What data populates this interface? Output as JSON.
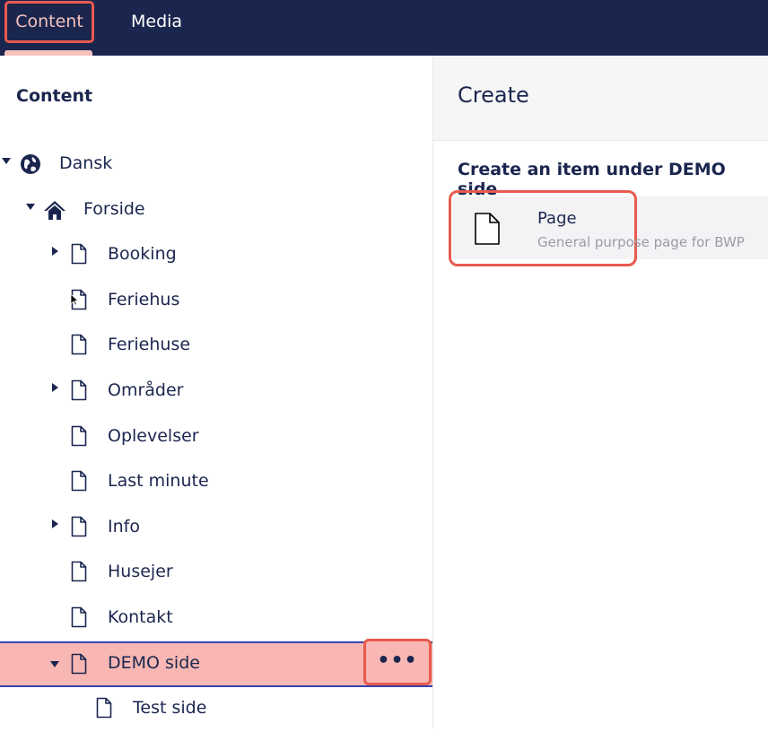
{
  "topnav": {
    "content_label": "Content",
    "media_label": "Media"
  },
  "tree": {
    "title": "Content",
    "rows": [
      {
        "label": "Dansk",
        "icon": "globe-icon",
        "expander": "down"
      },
      {
        "label": "Forside",
        "icon": "home-icon",
        "expander": "down"
      },
      {
        "label": "Booking",
        "icon": "document-icon",
        "expander": "right"
      },
      {
        "label": "Feriehus",
        "icon": "document-icon",
        "expander": "none"
      },
      {
        "label": "Feriehuse",
        "icon": "document-icon",
        "expander": "none"
      },
      {
        "label": "Områder",
        "icon": "document-icon",
        "expander": "right"
      },
      {
        "label": "Oplevelser",
        "icon": "document-icon",
        "expander": "none"
      },
      {
        "label": "Last minute",
        "icon": "document-icon",
        "expander": "none"
      },
      {
        "label": "Info",
        "icon": "document-icon",
        "expander": "right"
      },
      {
        "label": "Husejer",
        "icon": "document-icon",
        "expander": "none"
      },
      {
        "label": "Kontakt",
        "icon": "document-icon",
        "expander": "none"
      },
      {
        "label": "DEMO side",
        "icon": "document-icon",
        "expander": "down"
      },
      {
        "label": "Test side",
        "icon": "document-icon",
        "expander": "none"
      }
    ],
    "actions_label": "•••"
  },
  "create": {
    "title": "Create",
    "subtitle": "Create an item under DEMO side",
    "item": {
      "name": "Page",
      "description": "General purpose page for BWP"
    }
  },
  "colors": {
    "nav_bg": "#1b264f",
    "highlight": "#e85a4f",
    "selected_bg": "#f8b7b3"
  }
}
